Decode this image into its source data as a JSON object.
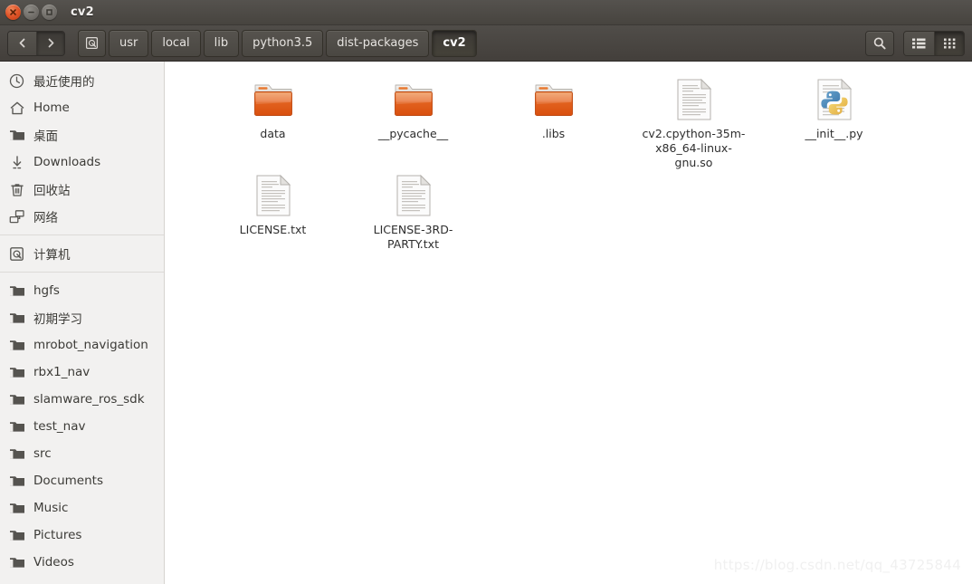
{
  "window": {
    "title": "cv2",
    "controls": {
      "close_label": "close-window",
      "minimize_label": "minimize-window",
      "maximize_label": "maximize-window"
    }
  },
  "toolbar": {
    "back_label": "Back",
    "forward_label": "Forward",
    "breadcrumbs": [
      {
        "label": "",
        "icon": "computer-icon",
        "active": false,
        "is_icon": true
      },
      {
        "label": "usr",
        "active": false
      },
      {
        "label": "local",
        "active": false
      },
      {
        "label": "lib",
        "active": false
      },
      {
        "label": "python3.5",
        "active": false
      },
      {
        "label": "dist-packages",
        "active": false
      },
      {
        "label": "cv2",
        "active": true
      }
    ],
    "search_label": "Search",
    "view_list_label": "List view",
    "view_grid_label": "Icon view",
    "active_view": "grid"
  },
  "sidebar": {
    "groups": [
      {
        "items": [
          {
            "label": "最近使用的",
            "icon": "clock-icon"
          },
          {
            "label": "Home",
            "icon": "home-icon"
          },
          {
            "label": "桌面",
            "icon": "folder-icon"
          },
          {
            "label": "Downloads",
            "icon": "download-icon"
          },
          {
            "label": "回收站",
            "icon": "trash-icon"
          },
          {
            "label": "网络",
            "icon": "network-icon"
          }
        ]
      },
      {
        "items": [
          {
            "label": "计算机",
            "icon": "computer-icon"
          }
        ]
      },
      {
        "items": [
          {
            "label": "hgfs",
            "icon": "folder-icon"
          },
          {
            "label": "初期学习",
            "icon": "folder-icon"
          },
          {
            "label": "mrobot_navigation",
            "icon": "folder-icon"
          },
          {
            "label": "rbx1_nav",
            "icon": "folder-icon"
          },
          {
            "label": "slamware_ros_sdk",
            "icon": "folder-icon"
          },
          {
            "label": "test_nav",
            "icon": "folder-icon"
          },
          {
            "label": "src",
            "icon": "folder-icon"
          },
          {
            "label": "Documents",
            "icon": "folder-icon"
          },
          {
            "label": "Music",
            "icon": "folder-icon"
          },
          {
            "label": "Pictures",
            "icon": "folder-icon"
          },
          {
            "label": "Videos",
            "icon": "folder-icon"
          }
        ]
      }
    ]
  },
  "content": {
    "files": [
      {
        "name": "data",
        "type": "folder"
      },
      {
        "name": "__pycache__",
        "type": "folder"
      },
      {
        "name": ".libs",
        "type": "folder"
      },
      {
        "name": "cv2.cpython-35m-x86_64-linux-gnu.so",
        "type": "document"
      },
      {
        "name": "__init__.py",
        "type": "python"
      },
      {
        "name": "LICENSE.txt",
        "type": "document"
      },
      {
        "name": "LICENSE-3RD-PARTY.txt",
        "type": "document"
      }
    ],
    "watermark": "https://blog.csdn.net/qq_43725844"
  },
  "colors": {
    "titlebar": "#4c4945",
    "toolbar": "#4a4742",
    "sidebar_bg": "#f2f1f0",
    "content_bg": "#ffffff",
    "folder_orange": "#dd4814",
    "close_button": "#df5428",
    "text_light": "#e6e3e0",
    "text_dark": "#3c3b37"
  }
}
